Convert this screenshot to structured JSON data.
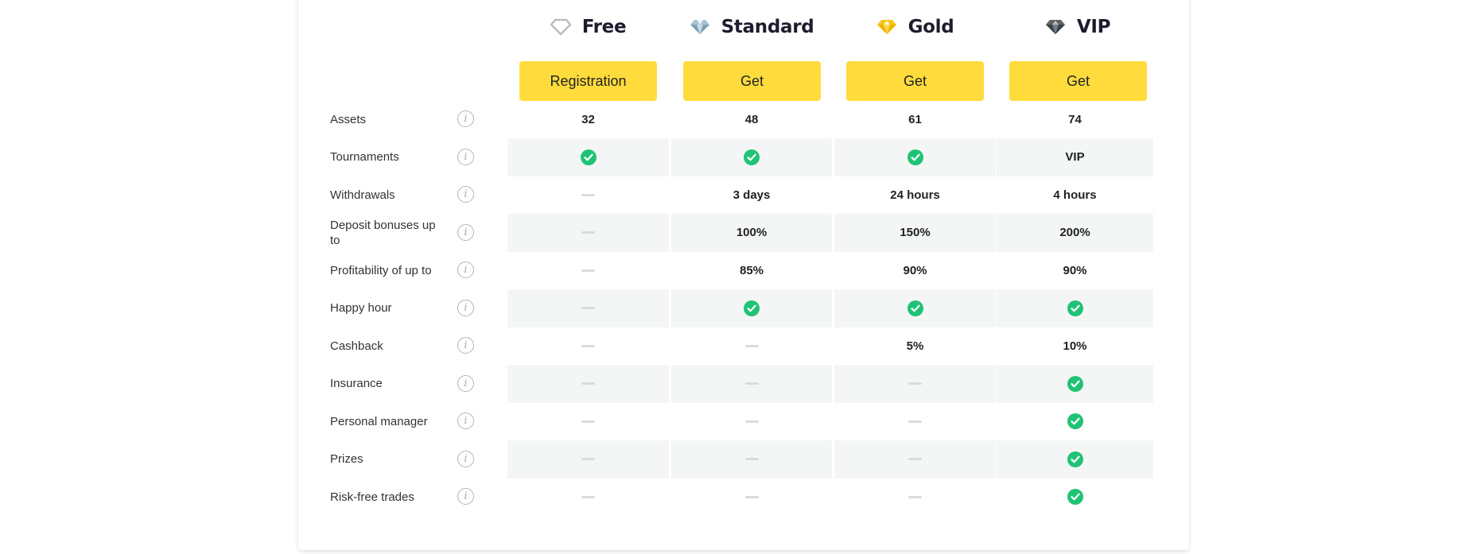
{
  "plans": [
    {
      "name": "Free",
      "icon": "diamond-outline-icon",
      "button": "Registration"
    },
    {
      "name": "Standard",
      "icon": "diamond-silver-icon",
      "button": "Get"
    },
    {
      "name": "Gold",
      "icon": "diamond-gold-icon",
      "button": "Get"
    },
    {
      "name": "VIP",
      "icon": "diamond-dark-icon",
      "button": "Get"
    }
  ],
  "colors": {
    "button": "#ffdc3c",
    "check": "#20c374",
    "stripe": "#f4f6f6",
    "title": "#1f1b2d"
  },
  "rows": [
    {
      "label": "Assets",
      "values": [
        "32",
        "48",
        "61",
        "74"
      ]
    },
    {
      "label": "Tournaments",
      "values": [
        "check",
        "check",
        "check",
        "VIP"
      ]
    },
    {
      "label": "Withdrawals",
      "values": [
        "dash",
        "3 days",
        "24 hours",
        "4 hours"
      ]
    },
    {
      "label": "Deposit bonuses up to",
      "values": [
        "dash",
        "100%",
        "150%",
        "200%"
      ]
    },
    {
      "label": "Profitability of up to",
      "values": [
        "dash",
        "85%",
        "90%",
        "90%"
      ]
    },
    {
      "label": "Happy hour",
      "values": [
        "dash",
        "check",
        "check",
        "check"
      ]
    },
    {
      "label": "Cashback",
      "values": [
        "dash",
        "dash",
        "5%",
        "10%"
      ]
    },
    {
      "label": "Insurance",
      "values": [
        "dash",
        "dash",
        "dash",
        "check"
      ]
    },
    {
      "label": "Personal manager",
      "values": [
        "dash",
        "dash",
        "dash",
        "check"
      ]
    },
    {
      "label": "Prizes",
      "values": [
        "dash",
        "dash",
        "dash",
        "check"
      ]
    },
    {
      "label": "Risk-free trades",
      "values": [
        "dash",
        "dash",
        "dash",
        "check"
      ]
    }
  ],
  "info_icon_glyph": "i"
}
